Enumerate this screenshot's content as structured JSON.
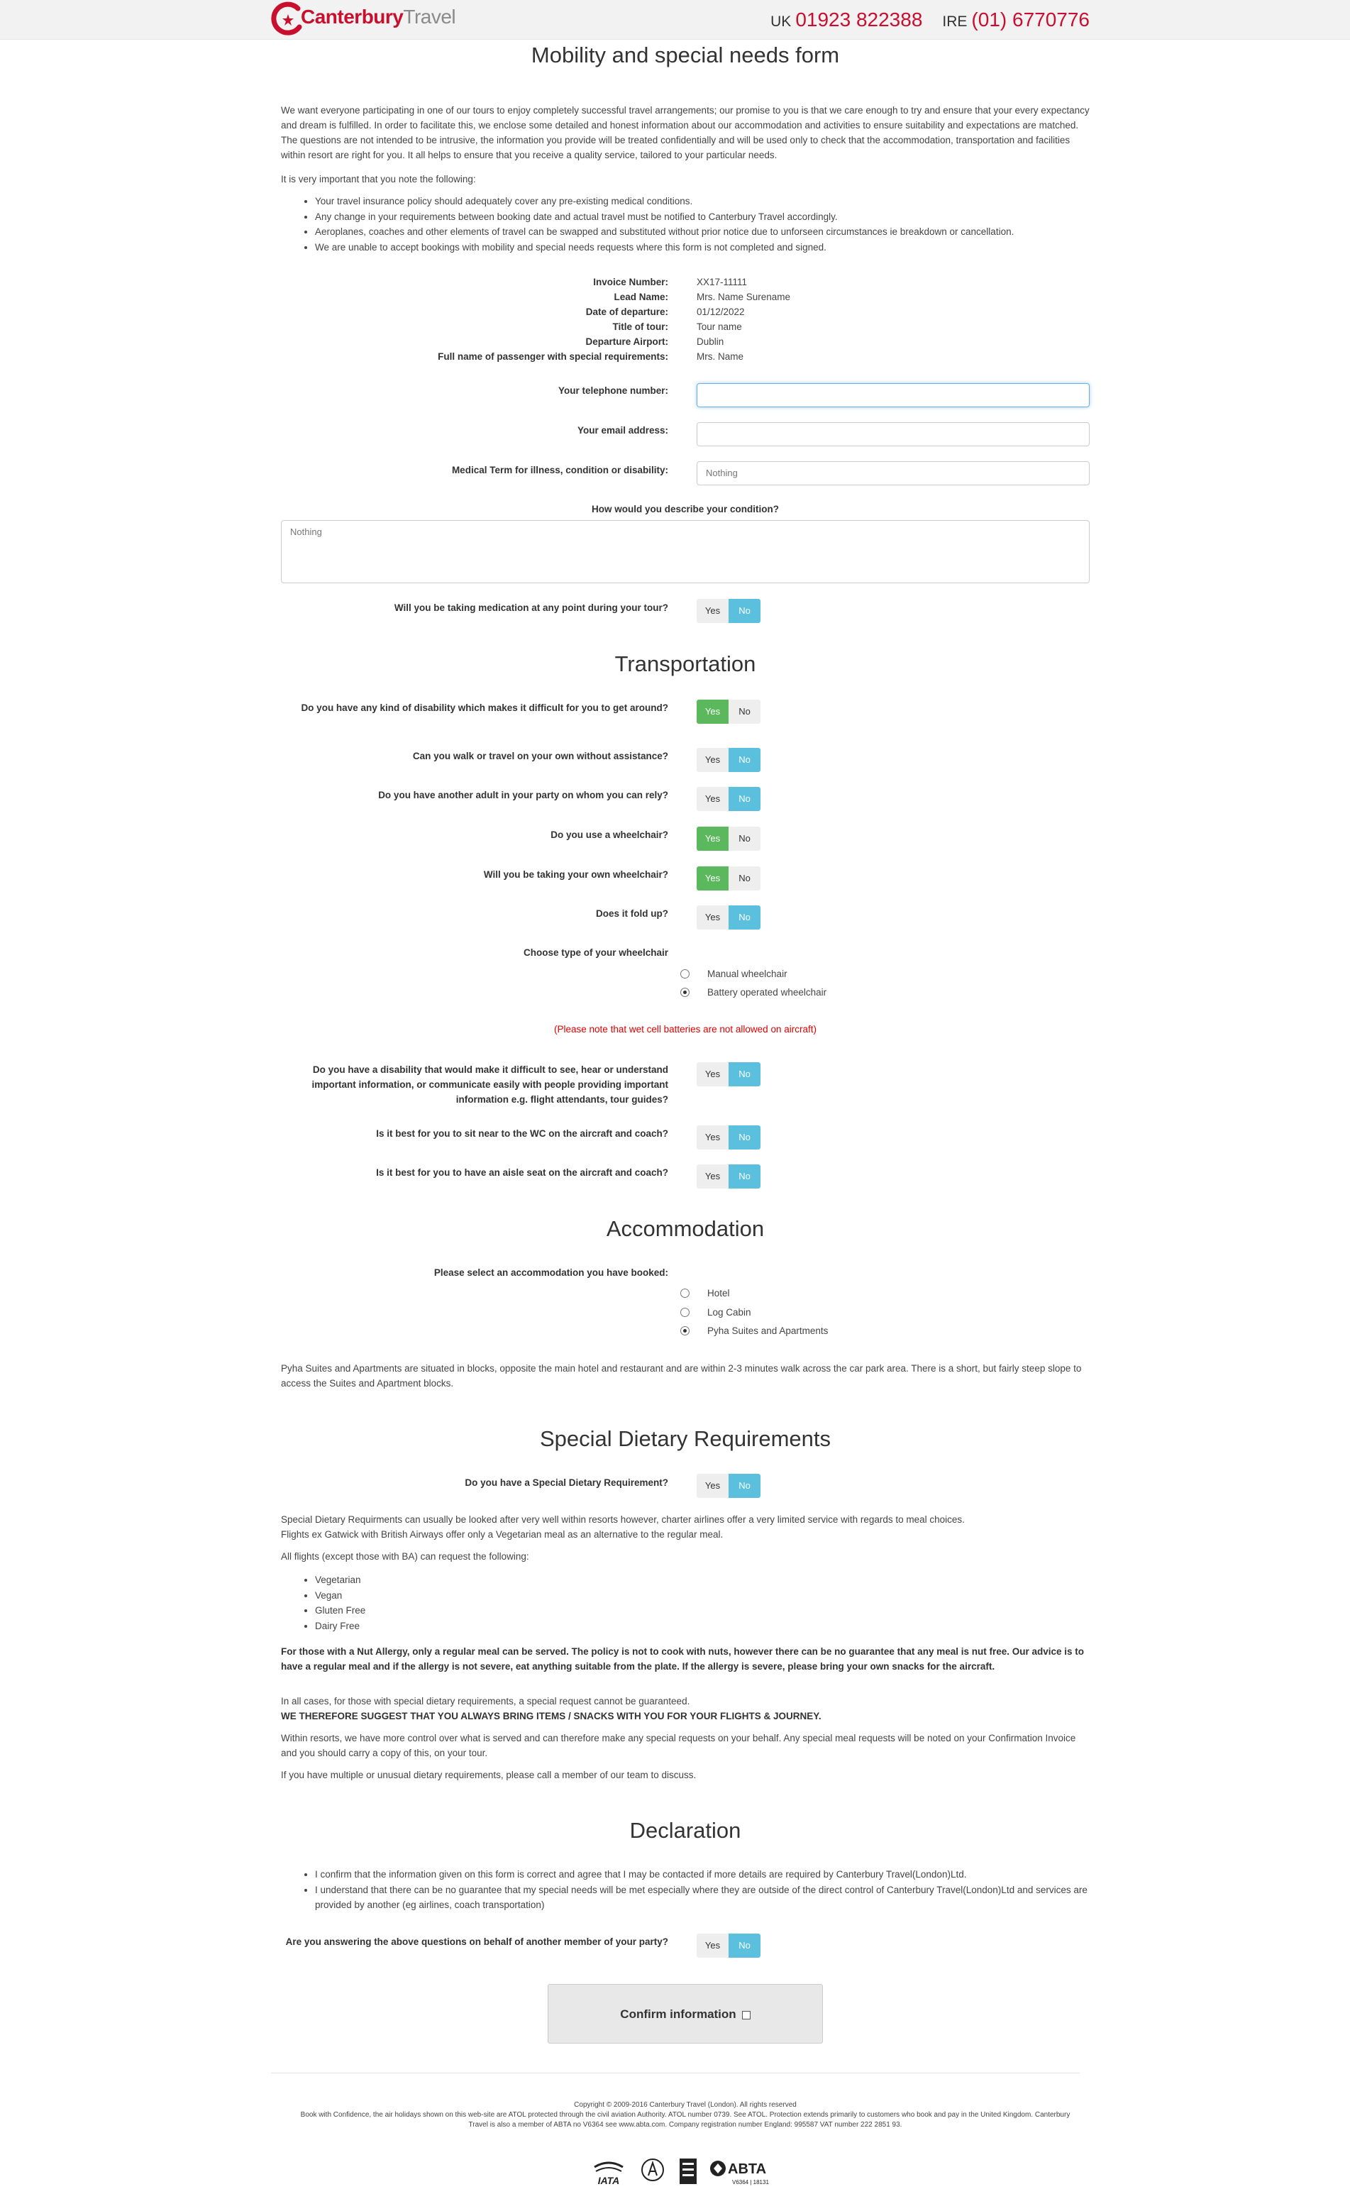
{
  "header": {
    "logo_bold": "Canterbury",
    "logo_light": "Travel",
    "uk_label": "UK",
    "uk_phone": "01923 822388",
    "ire_label": "IRE",
    "ire_phone": "(01) 6770776",
    "brand_color": "#c8102e"
  },
  "page": {
    "title": "Mobility and special needs form",
    "intro": "We want everyone participating in one of our tours to enjoy completely successful travel arrangements; our promise to you is that we care enough to try and ensure that your every expectancy and dream is fulfilled. In order to facilitate this, we enclose some detailed and honest information about our accommodation and activities to ensure suitability and expectations are matched. The questions are not intended to be intrusive, the information you provide will be treated confidentially and will be used only to check that the accommodation, transportation and facilities within resort are right for you. It all helps to ensure that you receive a quality service, tailored to your particular needs.",
    "important": "It is very important that you note the following:",
    "notes": [
      "Your travel insurance policy should adequately cover any pre-existing medical conditions.",
      "Any change in your requirements between booking date and actual travel must be notified to Canterbury Travel accordingly.",
      "Aeroplanes, coaches and other elements of travel can be swapped and substituted without prior notice due to unforseen circumstances ie breakdown or cancellation.",
      "We are unable to accept bookings with mobility and special needs requests where this form is not completed and signed."
    ]
  },
  "booking": [
    {
      "label": "Invoice Number:",
      "value": "XX17-11111"
    },
    {
      "label": "Lead Name:",
      "value": "Mrs. Name Surename"
    },
    {
      "label": "Date of departure:",
      "value": "01/12/2022"
    },
    {
      "label": "Title of tour:",
      "value": "Tour name"
    },
    {
      "label": "Departure Airport:",
      "value": "Dublin"
    },
    {
      "label": "Full name of passenger with special requirements:",
      "value": "Mrs. Name"
    }
  ],
  "fields": {
    "phone_label": "Your telephone number:",
    "phone_value": "",
    "email_label": "Your email address:",
    "email_value": "",
    "medical_label": "Medical Term for illness, condition or disability:",
    "medical_value": "Nothing",
    "describe_label": "How would you describe your condition?",
    "describe_value": "Nothing",
    "medication_label": "Will you be taking medication at any point during your tour?"
  },
  "toggle": {
    "yes": "Yes",
    "no": "No",
    "yes_color": "#5cb85c",
    "no_color": "#5bc0de"
  },
  "transportation": {
    "title": "Transportation",
    "q_disability": "Do you have any kind of disability which makes it difficult for you to get around?",
    "q_walk": "Can you walk or travel on your own without assistance?",
    "q_adult": "Do you have another adult in your party on whom you can rely?",
    "q_wheelchair": "Do you use a wheelchair?",
    "q_own_wheelchair": "Will you be taking your own wheelchair?",
    "q_fold": "Does it fold up?",
    "wheelchair_type_label": "Choose type of your wheelchair",
    "wheelchair_manual": "Manual wheelchair",
    "wheelchair_battery": "Battery operated wheelchair",
    "warning": "(Please note that wet cell batteries are not allowed on aircraft)",
    "q_communicate": "Do you have a disability that would make it difficult to see, hear or understand important information, or communicate easily with people providing important information e.g. flight attendants, tour guides?",
    "q_wc": "Is it best for you to sit near to the WC on the aircraft and coach?",
    "q_aisle": "Is it best for you to have an aisle seat on the aircraft and coach?"
  },
  "accommodation": {
    "title": "Accommodation",
    "label": "Please select an accommodation you have booked:",
    "options": [
      "Hotel",
      "Log Cabin",
      "Pyha Suites and Apartments"
    ],
    "selected": "Pyha Suites and Apartments",
    "note": "Pyha Suites and Apartments are situated in blocks, opposite the main hotel and restaurant and are within 2-3 minutes walk across the car park area. There is a short, but fairly steep slope to access the Suites and Apartment blocks."
  },
  "dietary": {
    "title": "Special Dietary Requirements",
    "question": "Do you have a Special Dietary Requirement?",
    "p1a": "Special Dietary Requirments can usually be looked after very well within resorts however, charter airlines offer a very limited service with regards to meal choices.",
    "p1b": "Flights ex Gatwick with British Airways offer only a Vegetarian meal as an alternative to the regular meal.",
    "p2": "All flights (except those with BA) can request the following:",
    "options": [
      "Vegetarian",
      "Vegan",
      "Gluten Free",
      "Dairy Free"
    ],
    "nut": "For those with a Nut Allergy, only a regular meal can be served. The policy is not to cook with nuts, however there can be no guarantee that any meal is nut free. Our advice is to have a regular meal and if the allergy is not severe, eat anything suitable from the plate. If the allergy is severe, please bring your own snacks for the aircraft.",
    "all_cases": "In all cases, for those with special dietary requirements, a special request cannot be guaranteed.",
    "suggest": "WE THEREFORE SUGGEST THAT YOU ALWAYS BRING ITEMS / SNACKS WITH YOU FOR YOUR FLIGHTS & JOURNEY.",
    "resorts": "Within resorts, we have more control over what is served and can therefore make any special requests on your behalf. Any special meal requests will be noted on your Confirmation Invoice and you should carry a copy of this, on your tour.",
    "multiple": "If you have multiple or unusual dietary requirements, please call a member of our team to discuss."
  },
  "declaration": {
    "title": "Declaration",
    "items": [
      "I confirm that the information given on this form is correct and agree that I may be contacted if more details are required by Canterbury Travel(London)Ltd.",
      "I understand that there can be no guarantee that my special needs will be met especially where they are outside of the direct control of Canterbury Travel(London)Ltd and services are provided by another (eg airlines, coach transportation)"
    ],
    "q_behalf": "Are you answering the above questions on behalf of another member of your party?",
    "confirm": "Confirm information"
  },
  "footer": {
    "copyright": "Copyright © 2009-2016 Canterbury Travel (London). All rights reserved",
    "legal": "Book with Confidence, the air holidays shown on this web-site are ATOL protected through the civil aviation Authority. ATOL number 0739. See ATOL. Protection extends primarily to customers who book and pay in the United Kingdom. Canterbury Travel is also a member of ABTA no V6364 see www.abta.com. Company registration number England: 995587 VAT number 222 2851 93.",
    "iata": "IATA",
    "abta": "ABTA",
    "abta_no": "V6364 | 18131"
  }
}
